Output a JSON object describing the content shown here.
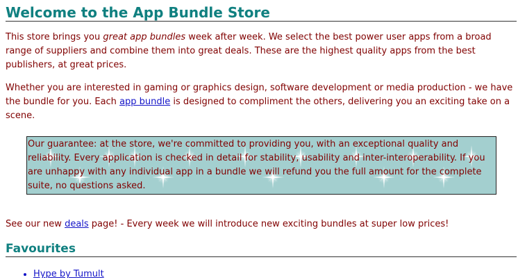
{
  "page": {
    "title": "Welcome to the App Bundle Store",
    "intro": {
      "before_em": "This store brings you ",
      "em": "great app bundles",
      "after_em": " week after week. We select the best power user apps from a broad range of suppliers and combine them into great deals. These are the highest quality apps from the best publishers, at great prices."
    },
    "para2": {
      "before_link": "Whether you are interested in gaming or graphics design, software development or media production - we have the bundle for you. Each ",
      "link_text": "app bundle",
      "after_link": " is designed to compliment the others, delivering you an exciting take on a scene."
    },
    "guarantee": "Our guarantee: at the store, we're committed to providing you, with an exceptional quality and reliability. Every application is checked in detail for stability, usability and inter-interoperability. If you are unhappy with any individual app in a bundle we will refund you the full amount for the complete suite, no questions asked.",
    "deals": {
      "before_link": "See our new ",
      "link_text": "deals",
      "after_link": " page! - Every week we will introduce new exciting bundles at super low prices!"
    },
    "favourites": {
      "title": "Favourites",
      "items": [
        "Hype by Tumult"
      ]
    }
  },
  "colors": {
    "heading": "#108080",
    "text": "#800000",
    "link": "#1515c8",
    "guarantee_bg": "#a3cfcf"
  }
}
